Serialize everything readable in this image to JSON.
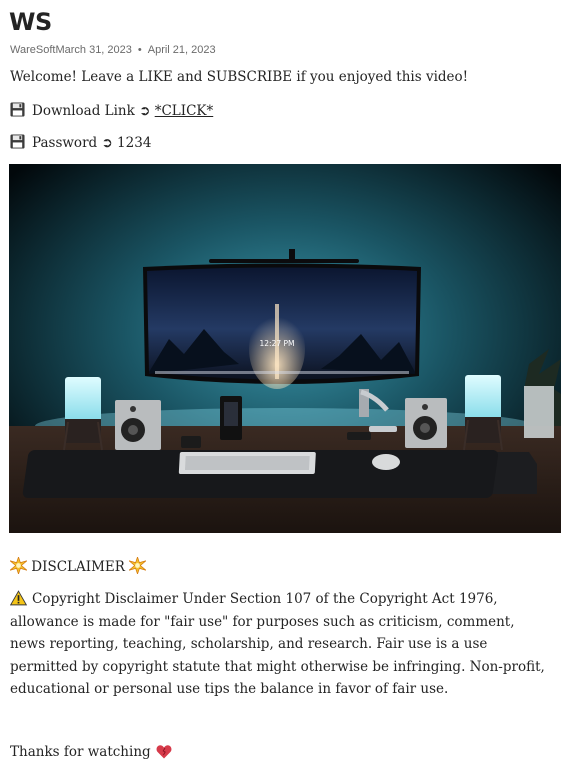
{
  "post": {
    "title": "WS",
    "author": "WareSoft",
    "published": "March 31, 2023",
    "updated": "April 21, 2023",
    "separator": "•"
  },
  "content": {
    "welcome": "Welcome! Leave a LIKE and SUBSCRIBE if you enjoyed this video!",
    "download_label": "Download Link ➲ ",
    "download_link": "*CLICK*",
    "password_label": "Password ➲ 1234",
    "hero_image": {
      "clock": "12:27 PM"
    },
    "disclaimer_title": "DISCLAIMER",
    "disclaimer_text": "Copyright Disclaimer Under Section 107 of the Copyright Act 1976, allowance is made for \"fair use\" for purposes such as criticism, comment, news reporting, teaching, scholarship, and research. Fair use is a use permitted by copyright statute that might otherwise be infringing. Non-profit, educational or personal use tips the balance in favor of fair use.",
    "thanks": "Thanks for watching"
  },
  "icons": {
    "download": "floppy-disk-icon",
    "password": "floppy-disk-icon",
    "disclaimer": "sparkle-icon",
    "warning": "warning-icon",
    "thanks": "heart-icon"
  },
  "colors": {
    "text": "#242424",
    "meta": "#6b6b6b",
    "warning": "#f5c518",
    "heart": "#d63a4a"
  }
}
